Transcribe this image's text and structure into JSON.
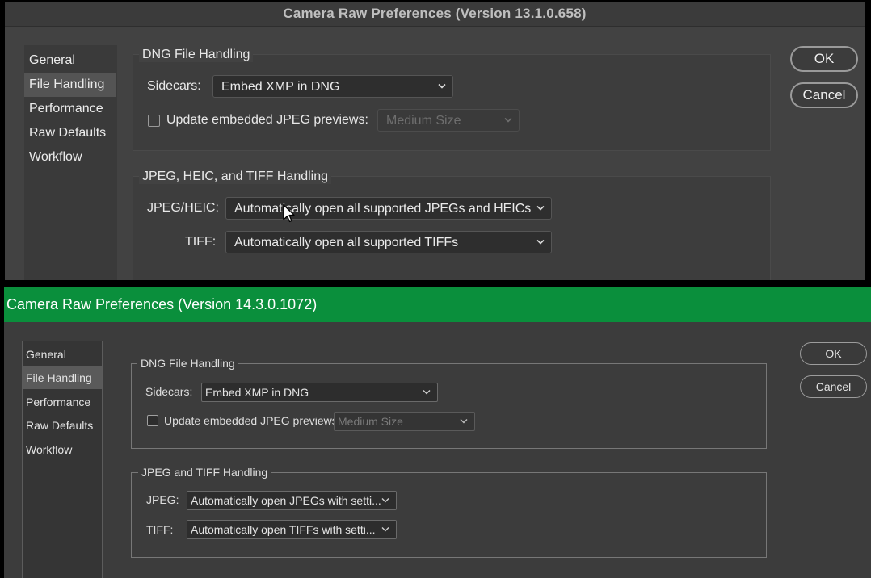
{
  "top_dialog": {
    "title": "Camera Raw Preferences  (Version 13.1.0.658)",
    "sidebar": {
      "items": [
        {
          "label": "General"
        },
        {
          "label": "File Handling",
          "selected": true
        },
        {
          "label": "Performance"
        },
        {
          "label": "Raw Defaults"
        },
        {
          "label": "Workflow"
        }
      ]
    },
    "dng_group": {
      "title": "DNG File Handling",
      "sidecars_label": "Sidecars:",
      "sidecars_value": "Embed XMP in DNG",
      "update_previews_label": "Update embedded JPEG previews:",
      "update_previews_checked": false,
      "preview_size_value": "Medium Size"
    },
    "jpeg_group": {
      "title": "JPEG, HEIC, and TIFF Handling",
      "jpeg_label": "JPEG/HEIC:",
      "jpeg_value": "Automatically open all supported JPEGs and HEICs",
      "tiff_label": "TIFF:",
      "tiff_value": "Automatically open all supported TIFFs"
    },
    "buttons": {
      "ok": "OK",
      "cancel": "Cancel"
    }
  },
  "bottom_dialog": {
    "title": "Camera Raw Preferences  (Version 14.3.0.1072)",
    "title_bar_color": "#0a8f3c",
    "sidebar": {
      "items": [
        {
          "label": "General"
        },
        {
          "label": "File Handling",
          "selected": true
        },
        {
          "label": "Performance"
        },
        {
          "label": "Raw Defaults"
        },
        {
          "label": "Workflow"
        }
      ]
    },
    "dng_group": {
      "title": "DNG File Handling",
      "sidecars_label": "Sidecars:",
      "sidecars_value": "Embed XMP in DNG",
      "update_previews_label": "Update embedded JPEG previews:",
      "update_previews_checked": false,
      "preview_size_value": "Medium Size"
    },
    "jpeg_group": {
      "title": "JPEG and TIFF Handling",
      "jpeg_label": "JPEG:",
      "jpeg_value": "Automatically open JPEGs with setti...",
      "tiff_label": "TIFF:",
      "tiff_value": "Automatically open TIFFs with setti..."
    },
    "buttons": {
      "ok": "OK",
      "cancel": "Cancel"
    }
  },
  "icons": {
    "dropdown": "chevron-down-icon",
    "pointer": "mouse-pointer-icon"
  }
}
